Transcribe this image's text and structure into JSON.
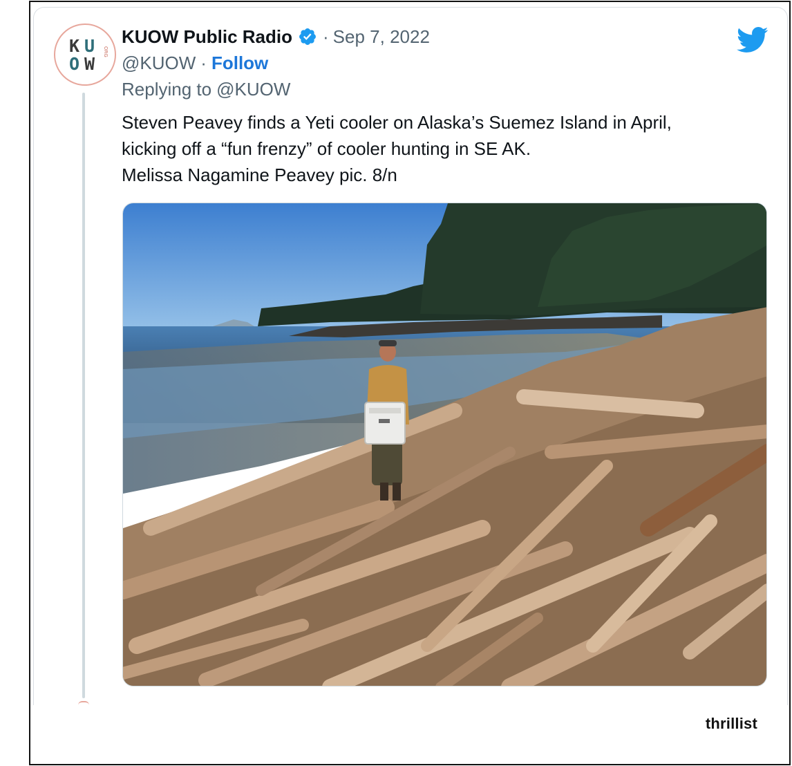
{
  "tweet": {
    "display_name": "KUOW Public Radio",
    "separator": "·",
    "date": "Sep 7, 2022",
    "handle": "@KUOW",
    "follow_label": "Follow",
    "replying_prefix": "Replying to",
    "replying_handle": "@KUOW",
    "text_lines": [
      "Steven Peavey finds a Yeti cooler on Alaska’s Suemez Island in April,",
      "kicking off a “fun frenzy” of cooler hunting in SE AK.",
      "Melissa Nagamine Peavey pic. 8/n"
    ]
  },
  "avatar": {
    "logo_letters": [
      "K",
      "U",
      "O",
      "W"
    ],
    "logo_suffix": "ORG"
  },
  "icons": {
    "verified": "verified-badge-icon",
    "twitter": "twitter-bird-icon"
  },
  "colors": {
    "link_blue": "#1d77d9",
    "twitter_blue": "#1d9bf0",
    "muted_text": "#536471",
    "avatar_ring": "#e7a79c"
  },
  "watermark": "thrillist"
}
